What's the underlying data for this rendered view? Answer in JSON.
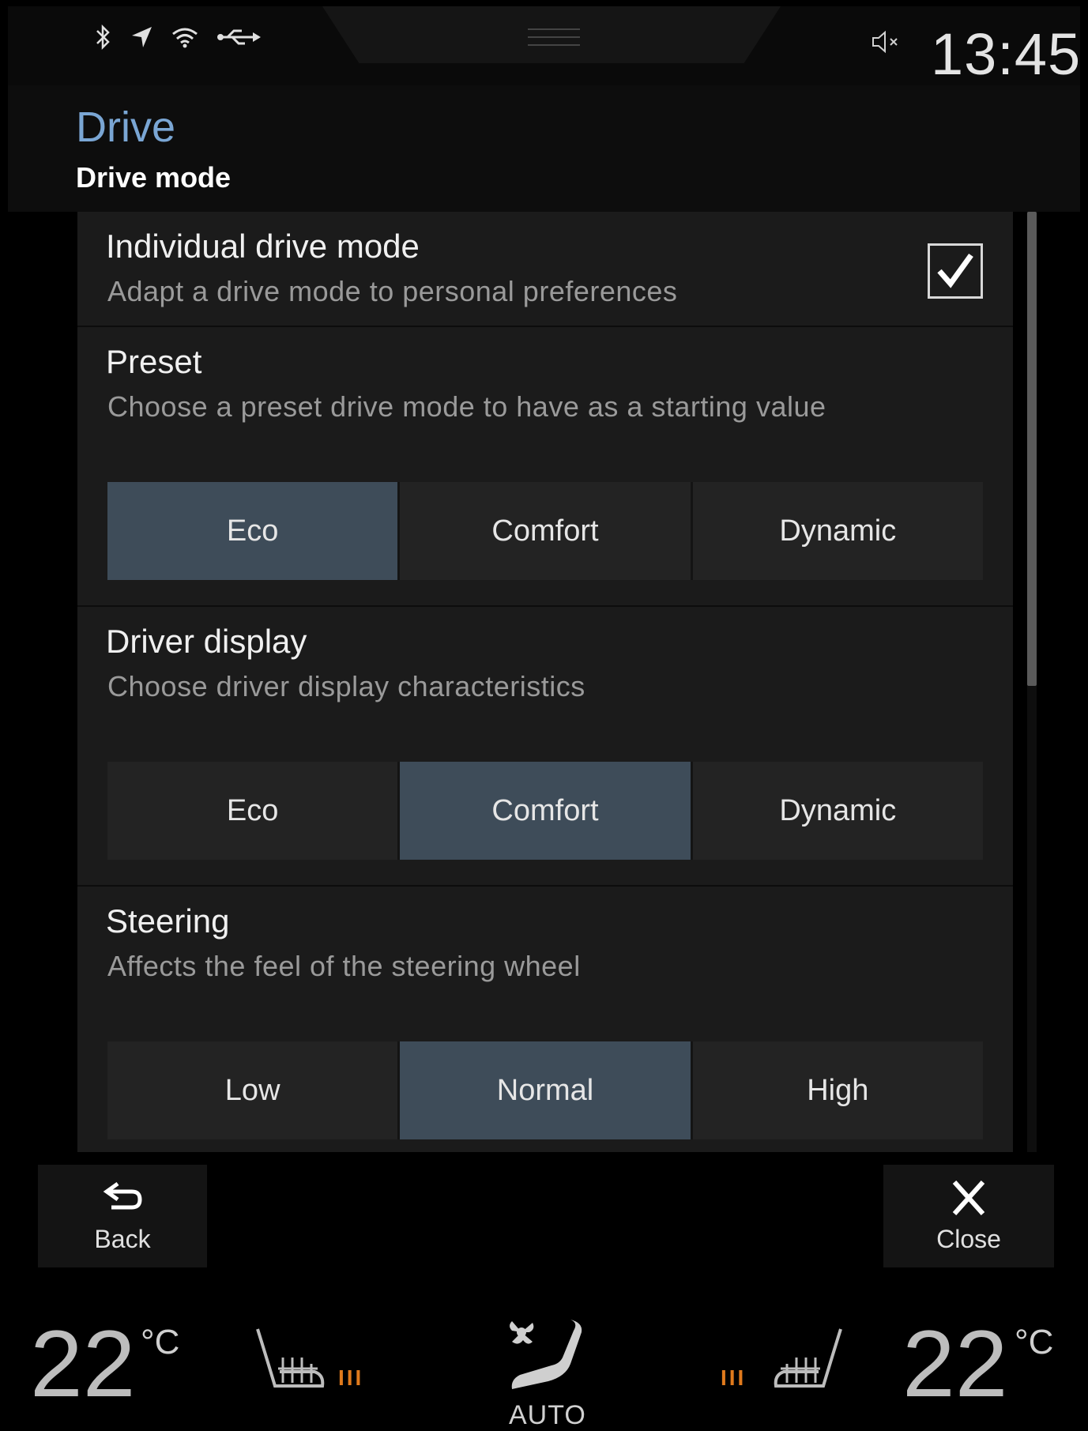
{
  "status_bar": {
    "icons": [
      "bluetooth-icon",
      "navigation-arrow-icon",
      "wifi-icon",
      "usb-icon"
    ],
    "mute_icon": "speaker-muted-icon",
    "time": "13:45"
  },
  "header": {
    "app_title": "Drive",
    "page_title": "Drive mode"
  },
  "settings": {
    "individual": {
      "title": "Individual drive mode",
      "subtitle": "Adapt a drive mode to personal preferences",
      "checked": true
    },
    "preset": {
      "title": "Preset",
      "subtitle": "Choose a preset drive mode to have as a starting value",
      "options": [
        "Eco",
        "Comfort",
        "Dynamic"
      ],
      "selected": "Eco"
    },
    "driver_display": {
      "title": "Driver display",
      "subtitle": "Choose driver display characteristics",
      "options": [
        "Eco",
        "Comfort",
        "Dynamic"
      ],
      "selected": "Comfort"
    },
    "steering": {
      "title": "Steering",
      "subtitle": "Affects the feel of the steering wheel",
      "options": [
        "Low",
        "Normal",
        "High"
      ],
      "selected": "Normal"
    }
  },
  "nav": {
    "back_label": "Back",
    "close_label": "Close"
  },
  "climate": {
    "left_temp": "22",
    "right_temp": "22",
    "unit": "°C",
    "left_heat": "III",
    "right_heat": "III",
    "auto_label": "AUTO",
    "accent_heat_color": "#e07a1c"
  },
  "colors": {
    "title_blue": "#7aa6d4",
    "selected_segment": "#3e4c59"
  }
}
